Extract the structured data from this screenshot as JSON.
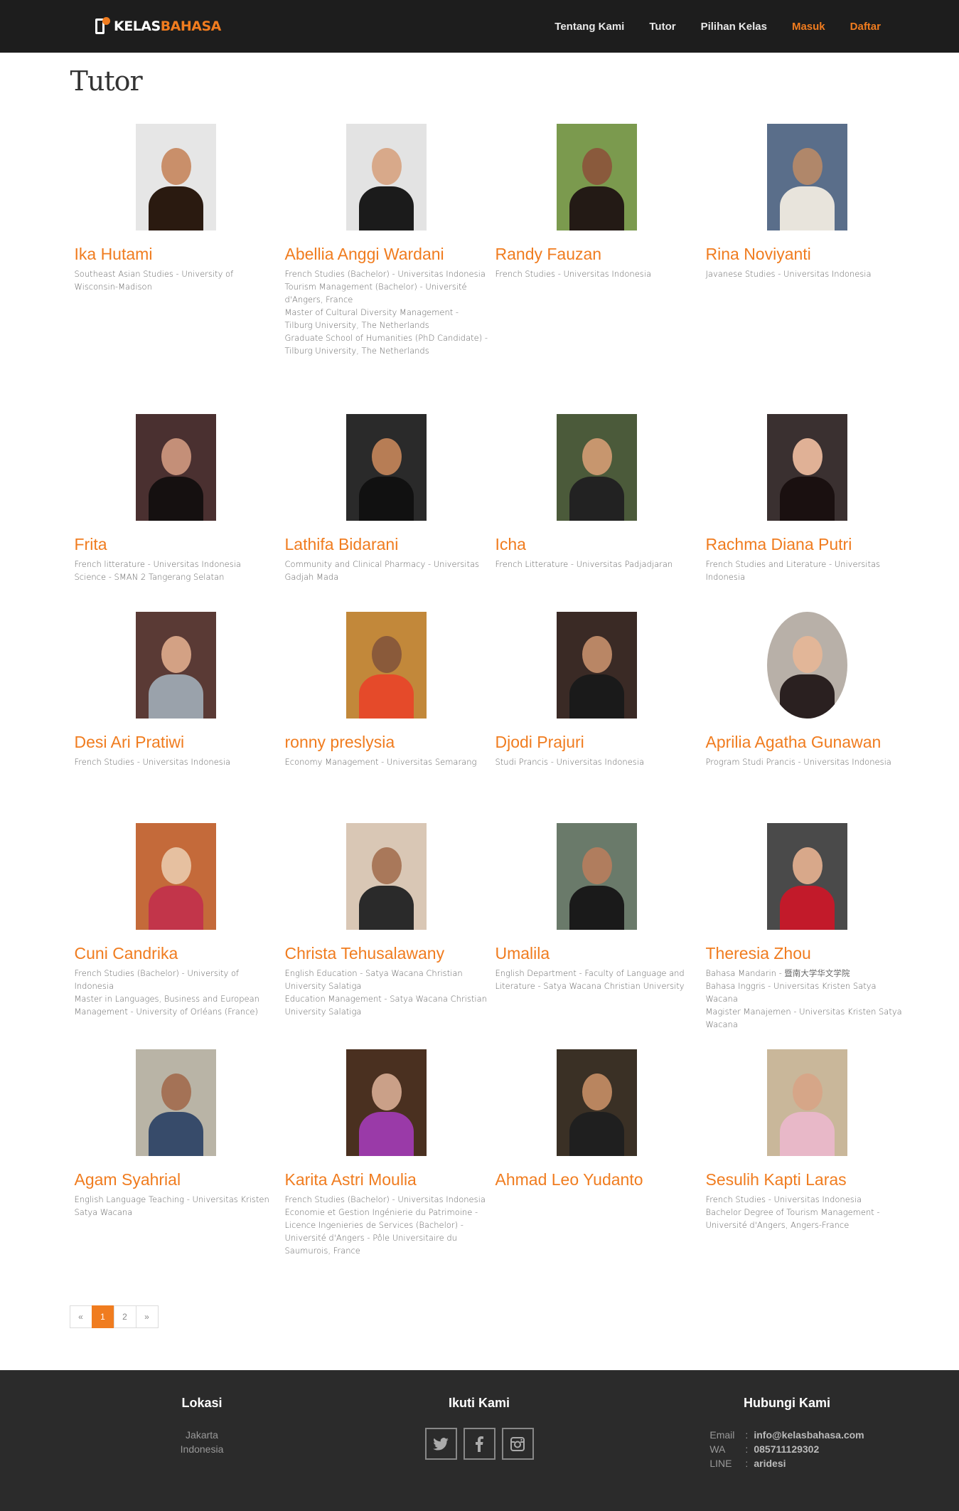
{
  "brand": {
    "logo_white": "KELAS",
    "logo_orange": "BAHASA"
  },
  "nav": [
    {
      "label": "Tentang Kami",
      "accent": false
    },
    {
      "label": "Tutor",
      "accent": false
    },
    {
      "label": "Pilihan Kelas",
      "accent": false
    },
    {
      "label": "Masuk",
      "accent": true
    },
    {
      "label": "Daftar",
      "accent": true
    }
  ],
  "page": {
    "title": "Tutor"
  },
  "tutors": [
    {
      "name": "Ika Hutami",
      "bio": [
        "Southeast Asian Studies - University of Wisconsin-Madison"
      ]
    },
    {
      "name": "Abellia Anggi Wardani",
      "bio": [
        "French Studies (Bachelor) - Universitas Indonesia",
        "Tourism Management (Bachelor) - Université d'Angers, France",
        "Master of Cultural Diversity Management - Tilburg University, The Netherlands",
        "Graduate School of Humanities (PhD Candidate) - Tilburg University, The Netherlands"
      ]
    },
    {
      "name": "Randy Fauzan",
      "bio": [
        "French Studies - Universitas Indonesia"
      ]
    },
    {
      "name": "Rina Noviyanti",
      "bio": [
        "Javanese Studies - Universitas Indonesia"
      ]
    },
    {
      "name": "Frita",
      "bio": [
        "French litterature - Universitas Indonesia",
        "Science - SMAN 2 Tangerang Selatan"
      ]
    },
    {
      "name": "Lathifa Bidarani",
      "bio": [
        "Community and Clinical Pharmacy - Universitas Gadjah Mada"
      ]
    },
    {
      "name": "Icha",
      "bio": [
        "French Litterature - Universitas Padjadjaran"
      ]
    },
    {
      "name": "Rachma Diana Putri",
      "bio": [
        "French Studies and Literature - Universitas Indonesia"
      ]
    },
    {
      "name": "Desi Ari Pratiwi",
      "bio": [
        "French Studies - Universitas Indonesia"
      ]
    },
    {
      "name": "ronny preslysia",
      "bio": [
        "Economy Management - Universitas Semarang"
      ]
    },
    {
      "name": "Djodi Prajuri",
      "bio": [
        "Studi Prancis - Universitas Indonesia"
      ]
    },
    {
      "name": "Aprilia Agatha Gunawan",
      "bio": [
        "Program Studi Prancis - Universitas Indonesia"
      ]
    },
    {
      "name": "Cuni Candrika",
      "bio": [
        "French Studies (Bachelor) - University of Indonesia",
        "Master in Languages, Business and European Management - University of Orléans (France)"
      ]
    },
    {
      "name": "Christa Tehusalawany",
      "bio": [
        "English Education - Satya Wacana Christian University Salatiga",
        "Education Management - Satya Wacana Christian University Salatiga"
      ]
    },
    {
      "name": "Umalila",
      "bio": [
        "English Department - Faculty of Language and Literature - Satya Wacana Christian University"
      ]
    },
    {
      "name": "Theresia Zhou",
      "bio": [
        "Bahasa Mandarin - 暨南大学华文学院",
        "Bahasa Inggris - Universitas Kristen Satya Wacana",
        "Magister Manajemen - Universitas Kristen Satya Wacana"
      ]
    },
    {
      "name": "Agam Syahrial",
      "bio": [
        "English Language Teaching - Universitas Kristen Satya Wacana"
      ]
    },
    {
      "name": "Karita Astri Moulia",
      "bio": [
        "French Studies (Bachelor) - Universitas Indonesia",
        "Economie et Gestion Ingénierie du Patrimoine - Licence Ingenieries de Services (Bachelor) - Université d'Angers - Pôle Universitaire du Saumurois, France"
      ]
    },
    {
      "name": "Ahmad Leo Yudanto",
      "bio": []
    },
    {
      "name": "Sesulih Kapti Laras",
      "bio": [
        "French Studies - Universitas Indonesia",
        "Bachelor Degree of Tourism Management - Université d'Angers, Angers-France"
      ]
    }
  ],
  "pagination": {
    "prev": "«",
    "pages": [
      "1",
      "2"
    ],
    "active": "1",
    "next": "»"
  },
  "footer": {
    "location": {
      "heading": "Lokasi",
      "city": "Jakarta",
      "country": "Indonesia"
    },
    "social": {
      "heading": "Ikuti Kami",
      "icons": [
        "twitter-icon",
        "facebook-icon",
        "instagram-icon"
      ]
    },
    "contact": {
      "heading": "Hubungi Kami",
      "rows": [
        {
          "key": "Email",
          "value": "info@kelasbahasa.com"
        },
        {
          "key": "WA",
          "value": "085711129302"
        },
        {
          "key": "LINE",
          "value": "aridesi"
        }
      ]
    }
  },
  "colors": {
    "accent": "#f07c1f",
    "navbar": "#1d1d1d",
    "footer": "#2b2b2b"
  }
}
